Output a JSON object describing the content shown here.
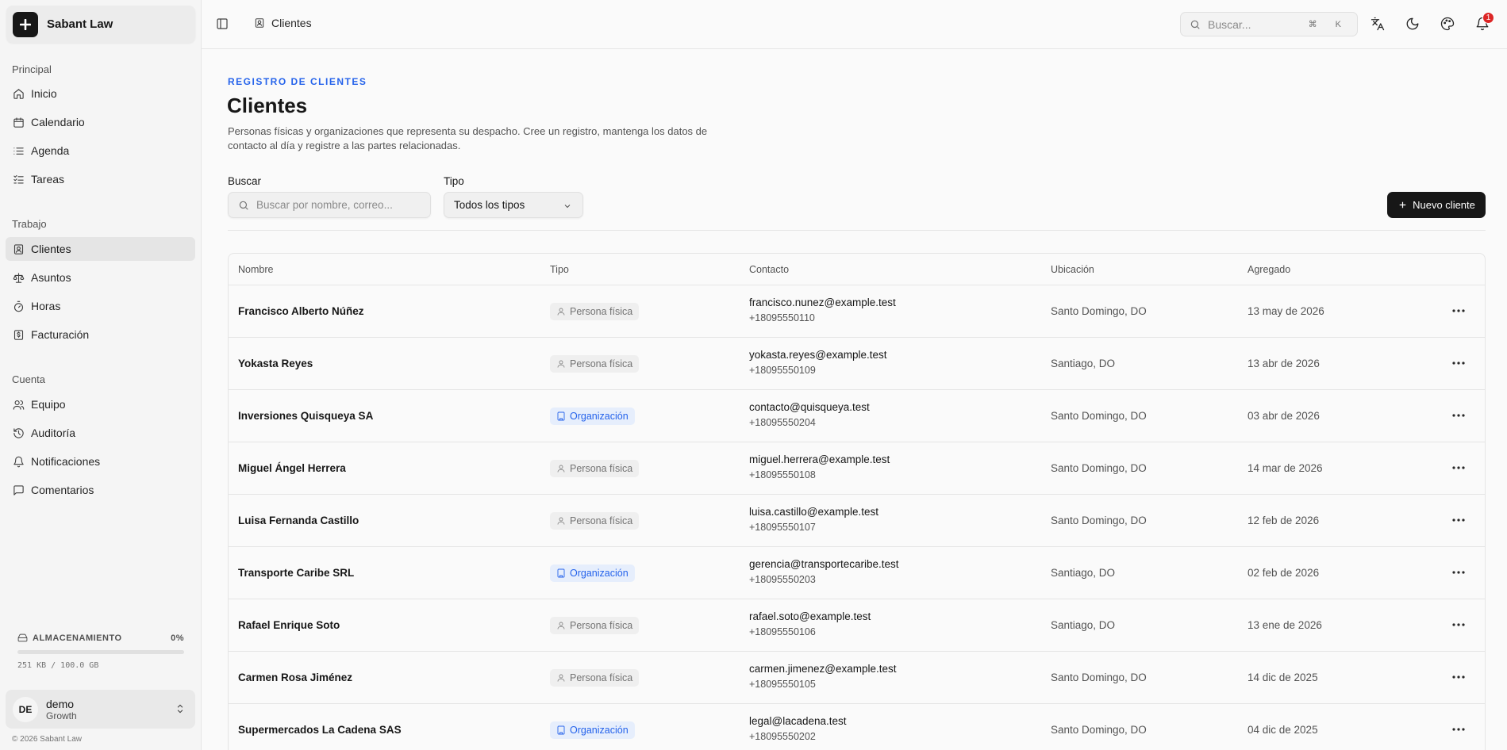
{
  "brand": {
    "name": "Sabant Law"
  },
  "sidebar": {
    "groups": [
      {
        "label": "Principal",
        "items": [
          {
            "label": "Inicio",
            "icon": "home-icon"
          },
          {
            "label": "Calendario",
            "icon": "calendar-icon"
          },
          {
            "label": "Agenda",
            "icon": "list-icon"
          },
          {
            "label": "Tareas",
            "icon": "tasks-icon"
          }
        ]
      },
      {
        "label": "Trabajo",
        "items": [
          {
            "label": "Clientes",
            "icon": "contact-icon",
            "active": true
          },
          {
            "label": "Asuntos",
            "icon": "scale-icon"
          },
          {
            "label": "Horas",
            "icon": "timer-icon"
          },
          {
            "label": "Facturación",
            "icon": "invoice-icon"
          }
        ]
      },
      {
        "label": "Cuenta",
        "items": [
          {
            "label": "Equipo",
            "icon": "users-icon"
          },
          {
            "label": "Auditoría",
            "icon": "history-icon"
          },
          {
            "label": "Notificaciones",
            "icon": "bell-icon"
          },
          {
            "label": "Comentarios",
            "icon": "comment-icon"
          }
        ]
      }
    ],
    "storage": {
      "label": "ALMACENAMIENTO",
      "percent_label": "0%",
      "percent": 0,
      "detail": "251 KB / 100.0 GB"
    },
    "user": {
      "initials": "DE",
      "name": "demo",
      "plan": "Growth"
    },
    "copyright": "© 2026 Sabant Law"
  },
  "topbar": {
    "breadcrumb": "Clientes",
    "search_placeholder": "Buscar...",
    "shortcut": "⌘ K",
    "notification_count": "1"
  },
  "page": {
    "eyebrow": "REGISTRO DE CLIENTES",
    "title": "Clientes",
    "description": "Personas físicas y organizaciones que representa su despacho. Cree un registro, mantenga los datos de contacto al día y registre a las partes relacionadas."
  },
  "filters": {
    "search_label": "Buscar",
    "search_placeholder": "Buscar por nombre, correo...",
    "type_label": "Tipo",
    "type_value": "Todos los tipos",
    "new_button": "Nuevo cliente"
  },
  "table": {
    "columns": [
      "Nombre",
      "Tipo",
      "Contacto",
      "Ubicación",
      "Agregado"
    ],
    "rows": [
      {
        "name": "Francisco Alberto Núñez",
        "type": "Persona física",
        "kind": "persona",
        "email": "francisco.nunez@example.test",
        "phone": "+18095550110",
        "location": "Santo Domingo, DO",
        "added": "13 may de 2026"
      },
      {
        "name": "Yokasta Reyes",
        "type": "Persona física",
        "kind": "persona",
        "email": "yokasta.reyes@example.test",
        "phone": "+18095550109",
        "location": "Santiago, DO",
        "added": "13 abr de 2026"
      },
      {
        "name": "Inversiones Quisqueya SA",
        "type": "Organización",
        "kind": "org",
        "email": "contacto@quisqueya.test",
        "phone": "+18095550204",
        "location": "Santo Domingo, DO",
        "added": "03 abr de 2026"
      },
      {
        "name": "Miguel Ángel Herrera",
        "type": "Persona física",
        "kind": "persona",
        "email": "miguel.herrera@example.test",
        "phone": "+18095550108",
        "location": "Santo Domingo, DO",
        "added": "14 mar de 2026"
      },
      {
        "name": "Luisa Fernanda Castillo",
        "type": "Persona física",
        "kind": "persona",
        "email": "luisa.castillo@example.test",
        "phone": "+18095550107",
        "location": "Santo Domingo, DO",
        "added": "12 feb de 2026"
      },
      {
        "name": "Transporte Caribe SRL",
        "type": "Organización",
        "kind": "org",
        "email": "gerencia@transportecaribe.test",
        "phone": "+18095550203",
        "location": "Santiago, DO",
        "added": "02 feb de 2026"
      },
      {
        "name": "Rafael Enrique Soto",
        "type": "Persona física",
        "kind": "persona",
        "email": "rafael.soto@example.test",
        "phone": "+18095550106",
        "location": "Santiago, DO",
        "added": "13 ene de 2026"
      },
      {
        "name": "Carmen Rosa Jiménez",
        "type": "Persona física",
        "kind": "persona",
        "email": "carmen.jimenez@example.test",
        "phone": "+18095550105",
        "location": "Santo Domingo, DO",
        "added": "14 dic de 2025"
      },
      {
        "name": "Supermercados La Cadena SAS",
        "type": "Organización",
        "kind": "org",
        "email": "legal@lacadena.test",
        "phone": "+18095550202",
        "location": "Santo Domingo, DO",
        "added": "04 dic de 2025"
      }
    ]
  }
}
